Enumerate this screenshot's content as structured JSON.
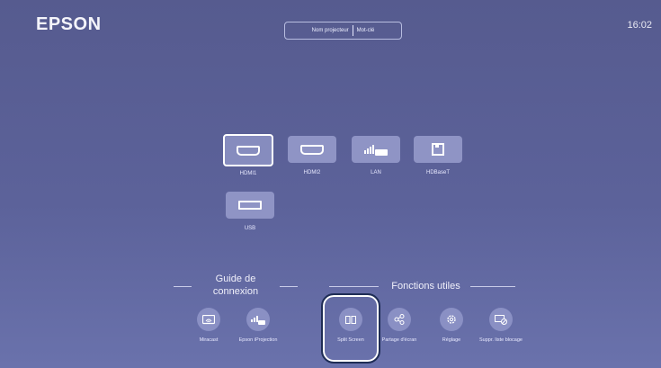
{
  "header": {
    "logo": "EPSON",
    "clock": "16:02",
    "projector_name": "Nom projecteur",
    "keyword": "Mot-clé"
  },
  "sources": [
    {
      "label": "HDMI1",
      "icon": "hdmi-icon",
      "selected": true
    },
    {
      "label": "HDMI2",
      "icon": "hdmi-icon",
      "selected": false
    },
    {
      "label": "LAN",
      "icon": "lan-icon",
      "selected": false
    },
    {
      "label": "HDBaseT",
      "icon": "hdbaset-icon",
      "selected": false
    },
    {
      "label": "USB",
      "icon": "usb-icon",
      "selected": false
    }
  ],
  "guide": {
    "title": "Guide de connexion",
    "items": [
      {
        "label": "Miracast",
        "icon": "miracast-icon"
      },
      {
        "label": "Epson iProjection",
        "icon": "iprojection-icon"
      }
    ]
  },
  "functions": {
    "title": "Fonctions utiles",
    "items": [
      {
        "label": "Split Screen",
        "icon": "split-screen-icon"
      },
      {
        "label": "Partage d'écran",
        "icon": "screen-share-icon"
      },
      {
        "label": "Réglage",
        "icon": "settings-gear-icon"
      },
      {
        "label": "Suppr. liste blocage",
        "icon": "unblock-list-icon"
      }
    ]
  },
  "colors": {
    "background": "#5c629a",
    "tile": "#8f94c5",
    "highlight_outline": "#1f2d55"
  }
}
